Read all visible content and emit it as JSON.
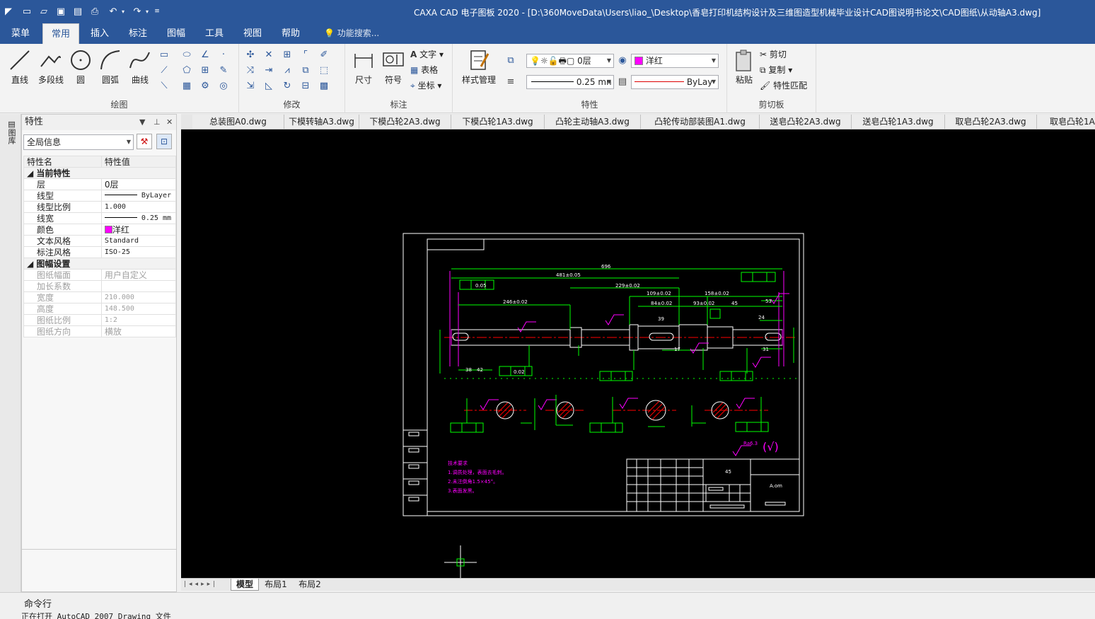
{
  "title": "CAXA CAD 电子图板 2020 - [D:\\360MoveData\\Users\\liao_\\Desktop\\香皂打印机结构设计及三维图造型机械毕业设计CAD图说明书论文\\CAD图纸\\从动轴A3.dwg]",
  "menu": {
    "tabs": [
      "菜单",
      "常用",
      "插入",
      "标注",
      "图幅",
      "工具",
      "视图",
      "帮助"
    ],
    "search": "功能搜索..."
  },
  "ribbon": {
    "draw": {
      "line": "直线",
      "polyline": "多段线",
      "circle": "圆",
      "arc": "圆弧",
      "curve": "曲线",
      "label": "绘图"
    },
    "modify": {
      "label": "修改"
    },
    "dim": {
      "size": "尺寸",
      "symbol": "符号",
      "text": "文字",
      "table": "表格",
      "coord": "坐标",
      "label": "标注"
    },
    "prop": {
      "style": "样式管理",
      "layer": "0层",
      "color": "洋红",
      "lineweight": "0.25 mn",
      "linetype": "ByLay",
      "label": "特性"
    },
    "clip": {
      "paste": "粘贴",
      "cut": "剪切",
      "copy": "复制",
      "match": "特性匹配",
      "label": "剪切板"
    }
  },
  "sidebar": {
    "strip": "图库"
  },
  "props": {
    "title": "特性",
    "scope": "全局信息",
    "col_name": "特性名",
    "col_value": "特性值",
    "sec1": "当前特性",
    "rows1": [
      {
        "n": "层",
        "v": "0层"
      },
      {
        "n": "线型",
        "v": "ByLayer"
      },
      {
        "n": "线型比例",
        "v": "1.000"
      },
      {
        "n": "线宽",
        "v": "0.25 mm"
      },
      {
        "n": "颜色",
        "v": "洋红"
      },
      {
        "n": "文本风格",
        "v": "Standard"
      },
      {
        "n": "标注风格",
        "v": "ISO-25"
      }
    ],
    "sec2": "图幅设置",
    "rows2": [
      {
        "n": "图纸幅面",
        "v": "用户自定义"
      },
      {
        "n": "加长系数",
        "v": ""
      },
      {
        "n": "宽度",
        "v": "210.000"
      },
      {
        "n": "高度",
        "v": "148.500"
      },
      {
        "n": "图纸比例",
        "v": "1:2"
      },
      {
        "n": "图纸方向",
        "v": "横放"
      }
    ]
  },
  "doc_tabs": [
    "总装图A0.dwg",
    "下模转轴A3.dwg",
    "下模凸轮2A3.dwg",
    "下模凸轮1A3.dwg",
    "凸轮主动轴A3.dwg",
    "凸轮传动部装图A1.dwg",
    "送皂凸轮2A3.dwg",
    "送皂凸轮1A3.dwg",
    "取皂凸轮2A3.dwg",
    "取皂凸轮1A"
  ],
  "drawing": {
    "dims": [
      "696",
      "481±0.05",
      "229±0.02",
      "109±0.02",
      "158±0.02",
      "246±0.02",
      "84±0.02",
      "93±0.02",
      "45",
      "53",
      "39",
      "24",
      "38",
      "42",
      "17",
      "31",
      "0.05",
      "0.02",
      "Ra6.3"
    ],
    "notes": [
      "技术要求",
      "1.调质处理，表面去毛刺。",
      "2.未注倒角1.5×45°。",
      "3.表面发黑。"
    ]
  },
  "layout_tabs": [
    "模型",
    "布局1",
    "布局2"
  ],
  "cmd": {
    "label": "命令行",
    "output": "正在打开 AutoCAD 2007 Drawing 文件"
  },
  "colors": {
    "accent": "#2b579a",
    "canvas": "#000000",
    "green": "#00ff00",
    "magenta": "#ff00ff",
    "red": "#ff0000"
  }
}
